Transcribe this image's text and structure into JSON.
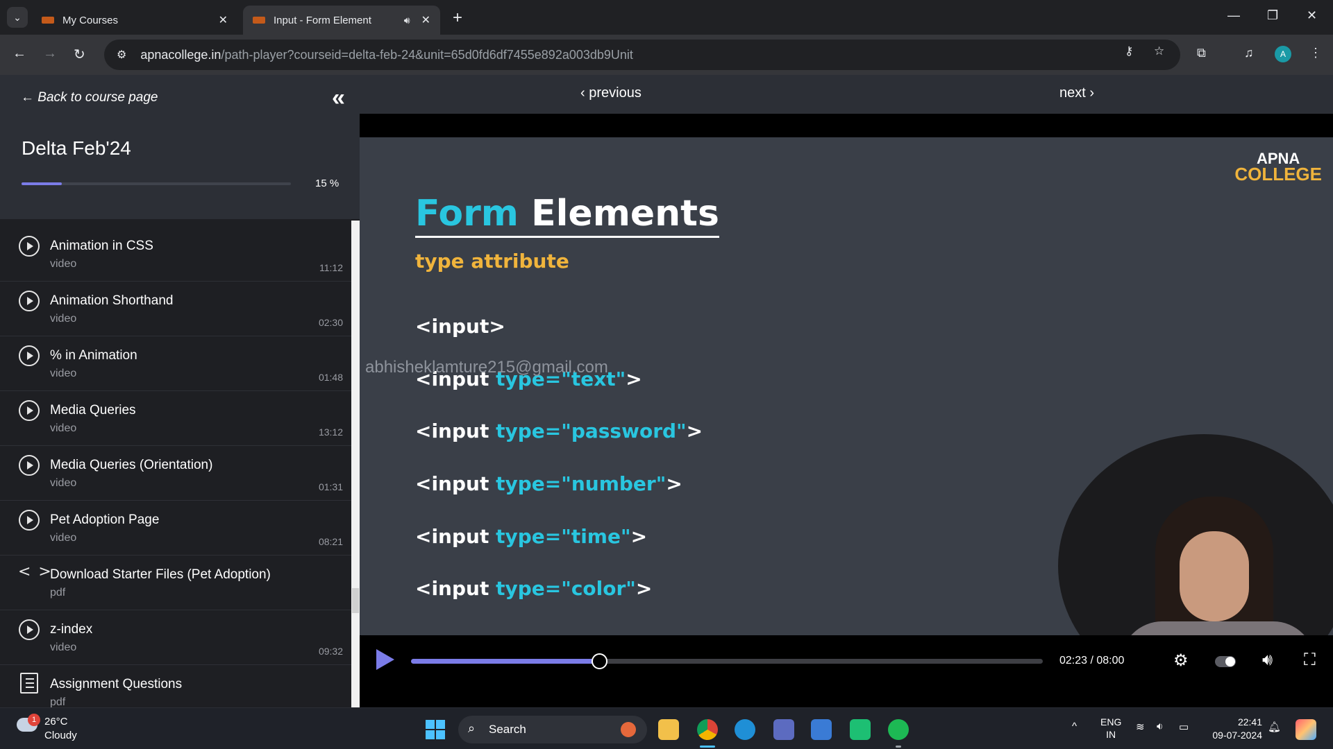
{
  "browser": {
    "tabs": [
      {
        "title": "My Courses",
        "active": false
      },
      {
        "title": "Input - Form Element",
        "active": true
      }
    ],
    "url_host": "apnacollege.in",
    "url_path": "/path-player?courseid=delta-feb-24&unit=65d0fd6df7455e892a003db9Unit",
    "profile_initial": "A"
  },
  "sidebar": {
    "back_label": "Back to course page",
    "course_title": "Delta Feb'24",
    "progress_text": "15 %",
    "progress_value": 0.15,
    "items": [
      {
        "name": "Animation in CSS",
        "type": "video",
        "duration": "11:12",
        "icon": "play-circle-icon"
      },
      {
        "name": "Animation Shorthand",
        "type": "video",
        "duration": "02:30",
        "icon": "play-circle-icon"
      },
      {
        "name": "% in Animation",
        "type": "video",
        "duration": "01:48",
        "icon": "play-circle-icon"
      },
      {
        "name": "Media Queries",
        "type": "video",
        "duration": "13:12",
        "icon": "play-circle-icon"
      },
      {
        "name": "Media Queries (Orientation)",
        "type": "video",
        "duration": "01:31",
        "icon": "play-circle-icon"
      },
      {
        "name": "Pet Adoption Page",
        "type": "video",
        "duration": "08:21",
        "icon": "play-circle-icon"
      },
      {
        "name": "Download Starter Files (Pet Adoption)",
        "type": "pdf",
        "duration": "",
        "icon": "code-icon"
      },
      {
        "name": "z-index",
        "type": "video",
        "duration": "09:32",
        "icon": "play-circle-icon"
      },
      {
        "name": "Assignment Questions",
        "type": "pdf",
        "duration": "",
        "icon": "assignment-icon"
      }
    ]
  },
  "content": {
    "prev_label": "previous",
    "next_label": "next",
    "slide": {
      "brand_line1": "APNA",
      "brand_line2": "COLLEGE",
      "title_word1": "Form",
      "title_word2": "Elements",
      "subtitle": "type attribute",
      "watermark": "abhisheklamture215@gmail.com",
      "lines": [
        {
          "pre": "<input",
          "attr": "",
          "post": ">"
        },
        {
          "pre": "<input ",
          "attr": "type=\"text\"",
          "post": ">"
        },
        {
          "pre": "<input ",
          "attr": "type=\"password\"",
          "post": ">"
        },
        {
          "pre": "<input ",
          "attr": "type=\"number\"",
          "post": ">"
        },
        {
          "pre": "<input ",
          "attr": "type=\"time\"",
          "post": ">"
        },
        {
          "pre": "<input ",
          "attr": "type=\"color\"",
          "post": ">"
        }
      ]
    },
    "player": {
      "time_text": "02:23 / 08:00",
      "played_fraction": 0.298
    }
  },
  "taskbar": {
    "temperature": "26°C",
    "condition": "Cloudy",
    "weather_badge": "1",
    "search_label": "Search",
    "lang_line1": "ENG",
    "lang_line2": "IN",
    "time": "22:41",
    "date": "09-07-2024"
  },
  "colors": {
    "accent": "#7b7ce8",
    "slide_bg": "#3a3f48",
    "code_attr": "#29c6e0",
    "brand_orange": "#f0b43c"
  }
}
